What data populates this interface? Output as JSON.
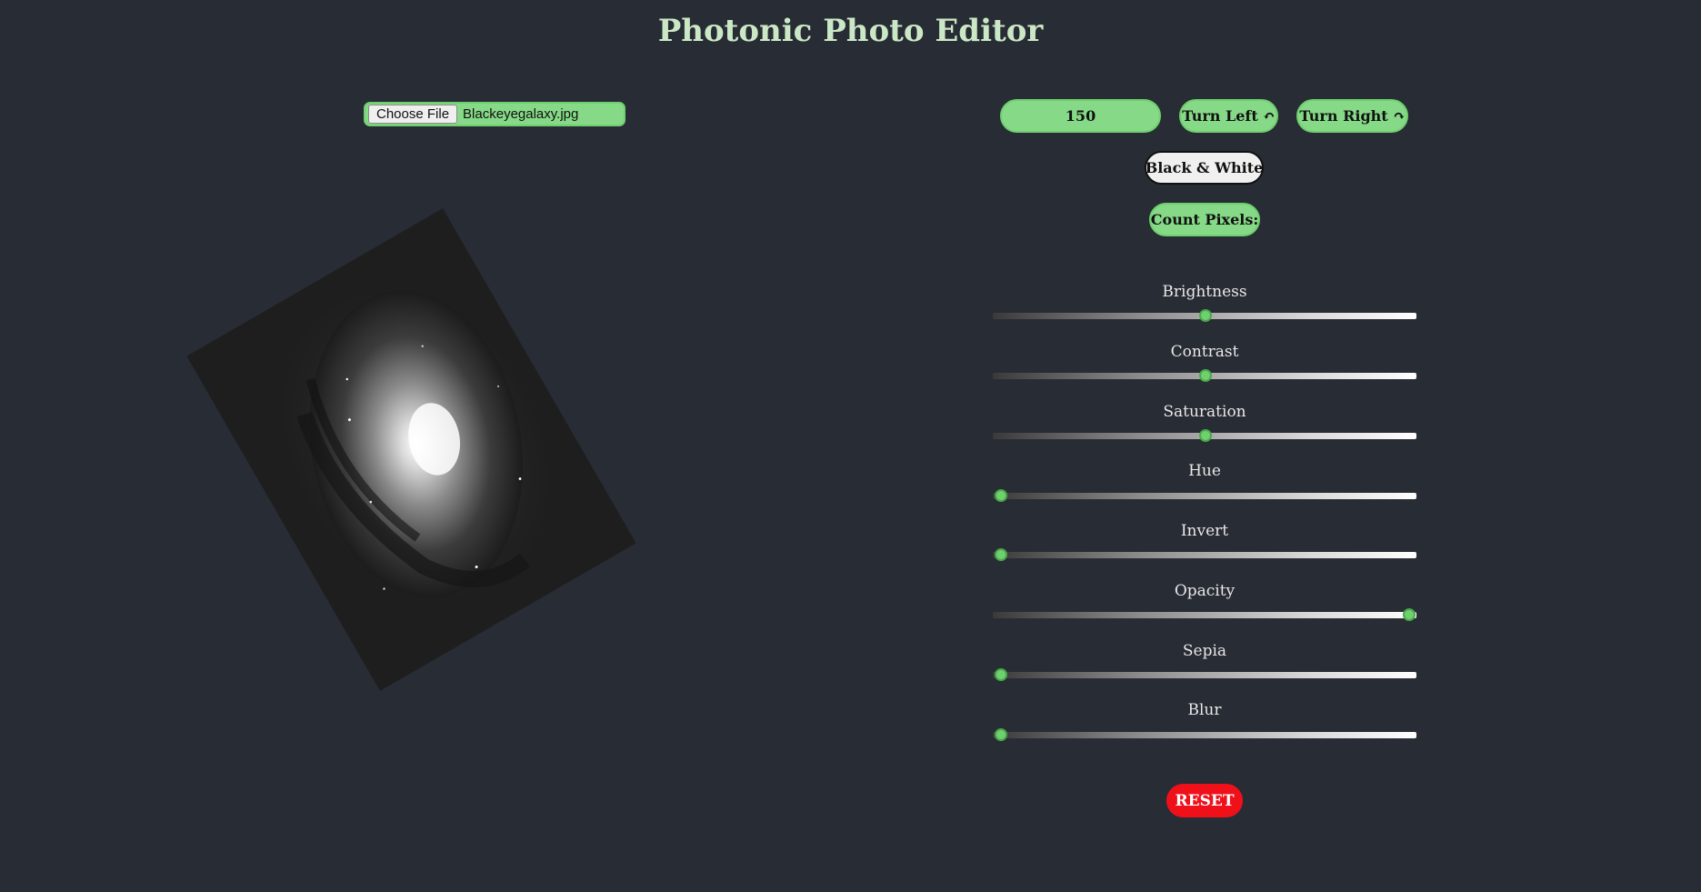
{
  "header": {
    "title": "Photonic Photo Editor"
  },
  "file": {
    "button_label": "Choose File",
    "file_name": "Blackeyegalaxy.jpg"
  },
  "controls": {
    "size_value": "150",
    "turn_left_label": "Turn Left ↶",
    "turn_right_label": "Turn Right ↷",
    "black_white_label": "Black & White",
    "count_pixels_label": "Count Pixels:",
    "reset_label": "RESET"
  },
  "image": {
    "rotation_deg": -30
  },
  "sliders": [
    {
      "label": "Brightness",
      "value_fraction": 0.5
    },
    {
      "label": "Contrast",
      "value_fraction": 0.5
    },
    {
      "label": "Saturation",
      "value_fraction": 0.5
    },
    {
      "label": "Hue",
      "value_fraction": 0
    },
    {
      "label": "Invert",
      "value_fraction": 0
    },
    {
      "label": "Opacity",
      "value_fraction": 1
    },
    {
      "label": "Sepia",
      "value_fraction": 0
    },
    {
      "label": "Blur",
      "value_fraction": 0
    }
  ],
  "colors": {
    "background": "#282c34",
    "accent_green": "#86d987",
    "reset_red": "#f0101a",
    "title": "#cbe8c6"
  }
}
